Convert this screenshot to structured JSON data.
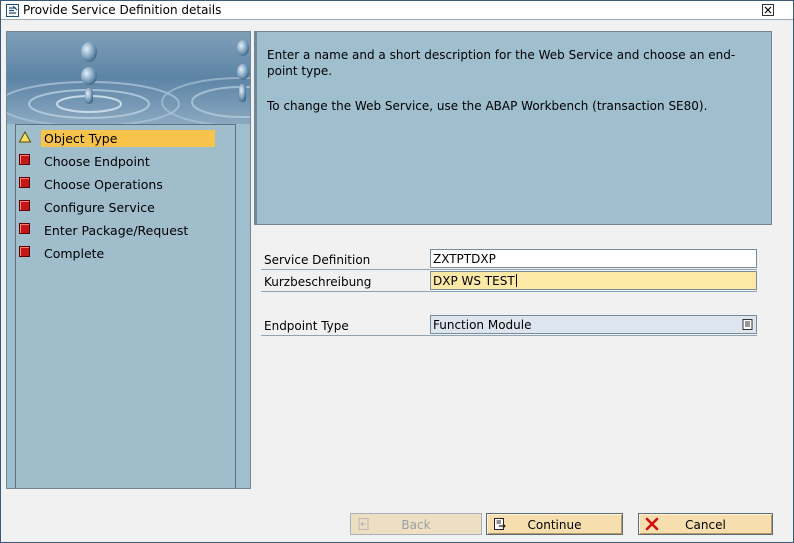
{
  "window": {
    "title": "Provide Service Definition details"
  },
  "steps": [
    {
      "label": "Object Type",
      "status": "current"
    },
    {
      "label": "Choose Endpoint",
      "status": "pending"
    },
    {
      "label": "Choose Operations",
      "status": "pending"
    },
    {
      "label": "Configure Service",
      "status": "pending"
    },
    {
      "label": "Enter Package/Request",
      "status": "pending"
    },
    {
      "label": "Complete",
      "status": "pending"
    }
  ],
  "info": {
    "line1": "Enter a name and a short description for the Web Service and choose an end-point type.",
    "line2": "To change the Web Service, use the ABAP Workbench (transaction SE80)."
  },
  "form": {
    "service_definition": {
      "label": "Service Definition",
      "value": "ZXTPTDXP"
    },
    "short_description": {
      "label": "Kurzbeschreibung",
      "value": "DXP WS TEST"
    },
    "endpoint_type": {
      "label": "Endpoint Type",
      "value": "Function Module"
    }
  },
  "buttons": {
    "back": "Back",
    "continue": "Continue",
    "cancel": "Cancel"
  },
  "colors": {
    "panel": "#9fbfcf",
    "active_step": "#f7c34a",
    "required_field": "#fde9a6",
    "button": "#f6deae",
    "pending_marker": "#c41818"
  }
}
